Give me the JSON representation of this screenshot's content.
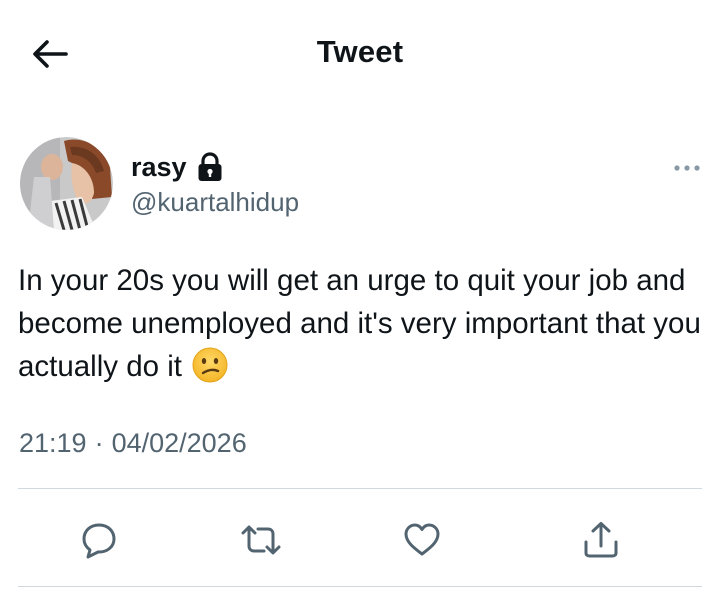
{
  "header": {
    "title": "Tweet",
    "back_icon": "arrow-left-icon"
  },
  "tweet": {
    "author": {
      "display_name": "rasy",
      "handle": "@kuartalhidup",
      "protected_icon": "lock-icon"
    },
    "more_icon": "more-horizontal-icon",
    "text": "In your 20s you will get an urge to quit your job and become unemployed and it's very important that you actually do it",
    "emoji": "confused-face-emoji",
    "time": "21:19",
    "separator": "·",
    "date": "04/02/2026"
  },
  "actions": [
    {
      "name": "reply",
      "icon": "reply-icon"
    },
    {
      "name": "retweet",
      "icon": "retweet-icon"
    },
    {
      "name": "like",
      "icon": "heart-icon"
    },
    {
      "name": "share",
      "icon": "share-icon"
    }
  ],
  "colors": {
    "text_primary": "#0f1419",
    "text_secondary": "#536471",
    "divider": "#cfd9de",
    "icon": "#536471"
  }
}
